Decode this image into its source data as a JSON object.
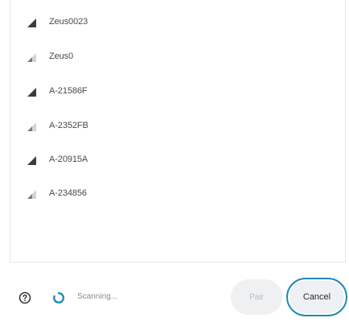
{
  "devices": [
    {
      "name": "Zeus0023",
      "signal": "strong"
    },
    {
      "name": "Zeus0",
      "signal": "weak"
    },
    {
      "name": "A-21586F",
      "signal": "strong"
    },
    {
      "name": "A-2352FB",
      "signal": "weak"
    },
    {
      "name": "A-20915A",
      "signal": "strong"
    },
    {
      "name": "A-234856",
      "signal": "weak"
    }
  ],
  "footer": {
    "help_icon": "question-circle-icon",
    "spinner_icon": "loading-spinner-icon",
    "status_text": "Scanning...",
    "pair_label": "Pair",
    "cancel_label": "Cancel"
  },
  "colors": {
    "accent": "#1e8ab3",
    "spinner": "#1e8ab3",
    "signal_strong": "#3c3c3c",
    "signal_weak": "#9a9a9a"
  }
}
